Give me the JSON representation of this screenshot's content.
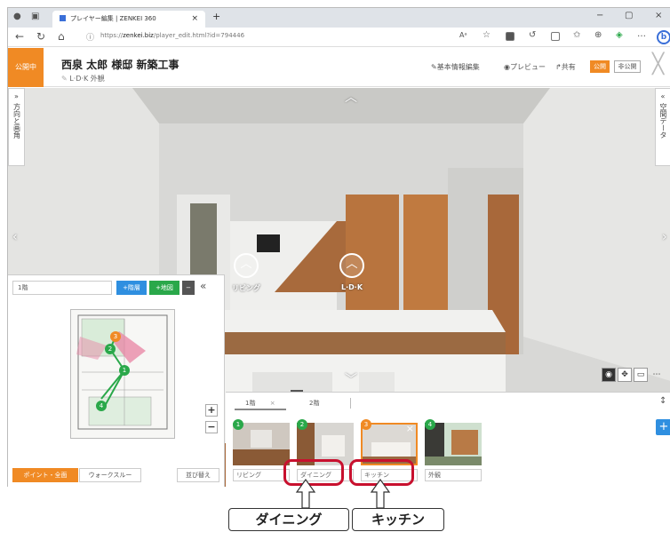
{
  "browser": {
    "tab_title": "プレイヤー編集 | ZENKEI 360",
    "tab_close": "×",
    "new_tab": "+",
    "url_prefix": "https://",
    "url_domain": "zenkei.biz",
    "url_rest": "/player_edit.html?id=794446",
    "minimize": "−",
    "maximize": "▢",
    "close": "×"
  },
  "header": {
    "status_badge": "公開中",
    "title": "西泉 太郎 様邸 新築工事",
    "subtitle": "L·D·K 外観",
    "basic_info": "基本情報編集",
    "preview": "プレビュー",
    "share": "共有",
    "publish": "公開",
    "unpublish": "非公開"
  },
  "side_panels": {
    "left_label": "方向と画角",
    "right_label": "空間データ"
  },
  "viewer": {
    "hotspots": [
      {
        "label": "リビング"
      },
      {
        "label": "L·D·K"
      }
    ]
  },
  "map_panel": {
    "floor_select": "1階",
    "add_floor": "+階層",
    "add_map": "+地図",
    "remove": "−",
    "collapse": "«",
    "zoom_in": "+",
    "zoom_out": "−",
    "point_mode": "ポイント・全面",
    "walkthrough": "ウォークスルー",
    "reorder": "並び替え",
    "points": [
      "1",
      "2",
      "3",
      "4"
    ]
  },
  "strip": {
    "floor_tabs": [
      {
        "label": "1階",
        "close": "×"
      },
      {
        "label": "2階"
      }
    ],
    "thumbnails": [
      {
        "num": "1",
        "label": "リビング"
      },
      {
        "num": "2",
        "label": "ダイニング"
      },
      {
        "num": "3",
        "label": "キッチン"
      },
      {
        "num": "4",
        "label": "外観"
      }
    ],
    "add": "+"
  },
  "callouts": {
    "dining": "ダイニング",
    "kitchen": "キッチン"
  },
  "colors": {
    "accent_orange": "#f08a24",
    "point_green": "#2aa84a",
    "button_blue": "#2f8fe0",
    "highlight_red": "#c8102e"
  }
}
